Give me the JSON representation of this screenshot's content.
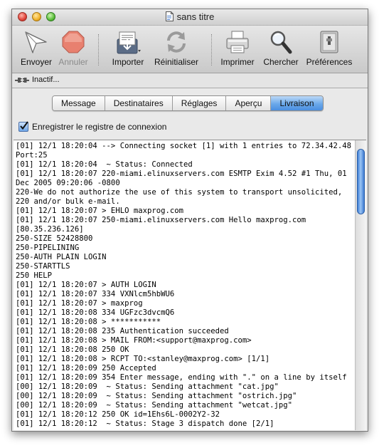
{
  "window": {
    "title": "sans titre"
  },
  "toolbar": {
    "items": [
      {
        "label": "Envoyer",
        "icon": "send-icon",
        "enabled": true
      },
      {
        "label": "Annuler",
        "icon": "stop-icon",
        "enabled": false
      },
      {
        "label": "Importer",
        "icon": "import-icon",
        "enabled": true
      },
      {
        "label": "Réinitialiser",
        "icon": "reset-icon",
        "enabled": true
      },
      {
        "label": "Imprimer",
        "icon": "printer-icon",
        "enabled": true
      },
      {
        "label": "Chercher",
        "icon": "magnifier-icon",
        "enabled": true
      },
      {
        "label": "Préférences",
        "icon": "preferences-icon",
        "enabled": true
      }
    ]
  },
  "status": {
    "text": "Inactif...",
    "icon": "plug-icon"
  },
  "tabs": {
    "items": [
      "Message",
      "Destinataires",
      "Réglages",
      "Aperçu",
      "Livraison"
    ],
    "selected": "Livraison"
  },
  "log_option": {
    "label": "Enregistrer le registre de connexion",
    "checked": true
  },
  "log": {
    "text": "[01] 12/1 18:20:04 --> Connecting socket [1] with 1 entries to 72.34.42.48 Port:25\n[01] 12/1 18:20:04  ~ Status: Connected\n[01] 12/1 18:20:07 220-miami.elinuxservers.com ESMTP Exim 4.52 #1 Thu, 01 Dec 2005 09:20:06 -0800\n220-We do not authorize the use of this system to transport unsolicited,\n220 and/or bulk e-mail.\n[01] 12/1 18:20:07 > EHLO maxprog.com\n[01] 12/1 18:20:07 250-miami.elinuxservers.com Hello maxprog.com\n[80.35.236.126]\n250-SIZE 52428800\n250-PIPELINING\n250-AUTH PLAIN LOGIN\n250-STARTTLS\n250 HELP\n[01] 12/1 18:20:07 > AUTH LOGIN\n[01] 12/1 18:20:07 334 VXNlcm5hbWU6\n[01] 12/1 18:20:07 > maxprog\n[01] 12/1 18:20:08 334 UGFzc3dvcmQ6\n[01] 12/1 18:20:08 > ***********\n[01] 12/1 18:20:08 235 Authentication succeeded\n[01] 12/1 18:20:08 > MAIL FROM:<support@maxprog.com>\n[01] 12/1 18:20:08 250 OK\n[01] 12/1 18:20:08 > RCPT TO:<stanley@maxprog.com> [1/1]\n[01] 12/1 18:20:09 250 Accepted\n[01] 12/1 18:20:09 354 Enter message, ending with \".\" on a line by itself\n[00] 12/1 18:20:09  ~ Status: Sending attachment \"cat.jpg\"\n[00] 12/1 18:20:09  ~ Status: Sending attachment \"ostrich.jpg\"\n[00] 12/1 18:20:09  ~ Status: Sending attachment \"wetcat.jpg\"\n[01] 12/1 18:20:12 250 OK id=1Ehs6L-0002Y2-32\n[01] 12/1 18:20:12  ~ Status: Stage 3 dispatch done [2/1]"
  }
}
